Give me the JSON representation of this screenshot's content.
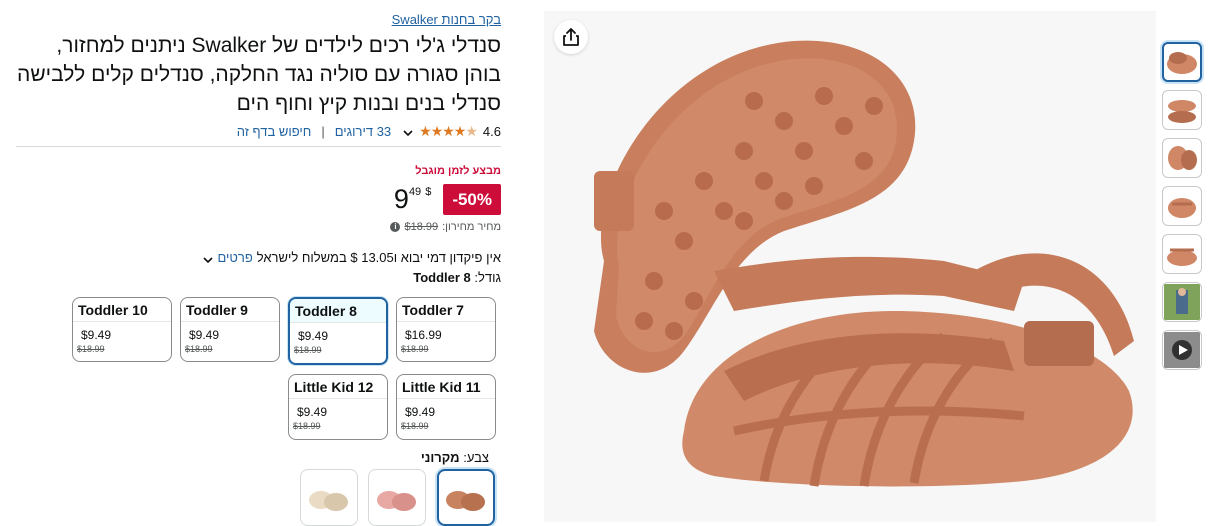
{
  "store": {
    "link_text": "בקר בחנות Swalker"
  },
  "product": {
    "title": "סנדלי ג'לי רכים לילדים של Swalker ניתנים למחזור, בוהן סגורה עם סוליה נגד החלקה, סנדלים קלים ללבישה סנדלי בנים ובנות קיץ וחוף הים"
  },
  "rating": {
    "value": "4.6",
    "stars": 4.6,
    "reviews_text": "33 דירוגים",
    "search_text": "חיפוש בדף זה",
    "separator": "|"
  },
  "deal": {
    "badge": "מבצע לזמן מוגבל"
  },
  "price": {
    "discount": "-50%",
    "currency": "$",
    "whole": "9",
    "fraction": "49",
    "list_label": "מחיר מחירון:",
    "list_value": "$18.99",
    "info_icon": "i"
  },
  "shipping": {
    "text": "אין פיקדון דמי יבוא ו13.05 $ במשלוח לישראל",
    "details_link": "פרטים"
  },
  "size": {
    "label": "גודל:",
    "selected": "Toddler 8",
    "options": [
      {
        "name": "Toddler 7",
        "price": "$16.99",
        "list_price": "$18.99"
      },
      {
        "name": "Toddler 8",
        "price": "$9.49",
        "list_price": "$18.99"
      },
      {
        "name": "Toddler 9",
        "price": "$9.49",
        "list_price": "$18.99"
      },
      {
        "name": "Toddler 10",
        "price": "$9.49",
        "list_price": "$18.99"
      },
      {
        "name": "Little Kid 11",
        "price": "$9.49",
        "list_price": "$18.99"
      },
      {
        "name": "Little Kid 12",
        "price": "$9.49",
        "list_price": "$18.99"
      }
    ]
  },
  "color": {
    "label": "צבע:",
    "selected": "מקרוני",
    "swatch_colors": [
      "#c9825f",
      "#e8a9a4",
      "#eadcc4"
    ]
  },
  "colors": {
    "sandal": "#cf8766",
    "sandal_dark": "#b56d4f",
    "link": "#2162a1",
    "deal_red": "#cc0c39",
    "star": "#de7921"
  },
  "icons": {
    "share": "share-icon",
    "chevron": "chevron-down-icon",
    "play": "play-icon"
  }
}
